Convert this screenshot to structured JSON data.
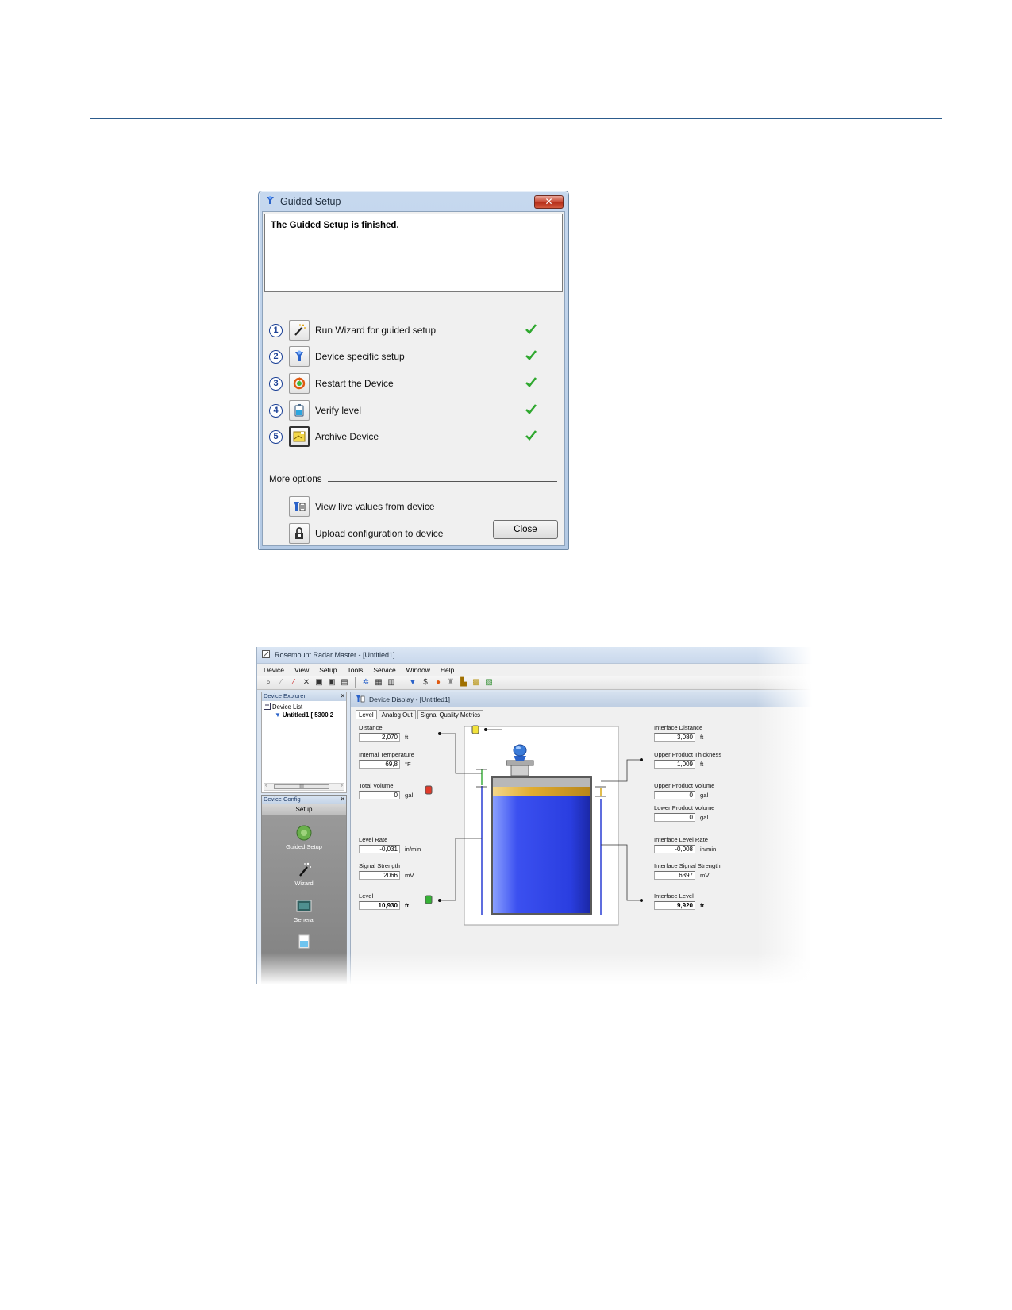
{
  "guided_setup": {
    "title": "Guided Setup",
    "message": "The Guided Setup is finished.",
    "steps": [
      {
        "num": "1",
        "label": "Run Wizard for guided setup",
        "icon": "wand-icon"
      },
      {
        "num": "2",
        "label": "Device specific setup",
        "icon": "radar-device-icon"
      },
      {
        "num": "3",
        "label": "Restart the Device",
        "icon": "restart-icon"
      },
      {
        "num": "4",
        "label": "Verify level",
        "icon": "tank-icon"
      },
      {
        "num": "5",
        "label": "Archive Device",
        "icon": "archive-icon"
      }
    ],
    "more_options_label": "More options",
    "options": [
      {
        "label": "View live values from device",
        "icon": "live-values-icon"
      },
      {
        "label": "Upload configuration to device",
        "icon": "upload-lock-icon"
      }
    ],
    "close_label": "Close"
  },
  "radar_master": {
    "title": "Rosemount Radar Master - [Untitled1]",
    "menu": [
      "Device",
      "View",
      "Setup",
      "Tools",
      "Service",
      "Window",
      "Help"
    ],
    "device_explorer": {
      "title": "Device Explorer",
      "device_list": "Device List",
      "device_entry": "Untitled1 [ 5300  2",
      "scroll_label": "III"
    },
    "device_config": {
      "title": "Device Config",
      "tab": "Setup",
      "items": [
        "Guided Setup",
        "Wizard",
        "General"
      ]
    },
    "device_display": {
      "title": "Device Display - [Untitled1]",
      "tabs": [
        "Level",
        "Analog Out",
        "Signal Quality Metrics"
      ],
      "left_fields": [
        {
          "label": "Distance",
          "value": "2,070",
          "unit": "ft"
        },
        {
          "label": "Internal Temperature",
          "value": "69,8",
          "unit": "°F"
        },
        {
          "label": "Total Volume",
          "value": "0",
          "unit": "gal"
        },
        {
          "label": "Level Rate",
          "value": "-0,031",
          "unit": "in/min"
        },
        {
          "label": "Signal Strength",
          "value": "2066",
          "unit": "mV"
        },
        {
          "label": "Level",
          "value": "10,930",
          "unit": "ft"
        }
      ],
      "right_fields": [
        {
          "label": "Interface Distance",
          "value": "3,080",
          "unit": "ft"
        },
        {
          "label": "Upper Product Thickness",
          "value": "1,009",
          "unit": "ft"
        },
        {
          "label": "Upper Product Volume",
          "value": "0",
          "unit": "gal"
        },
        {
          "label": "Lower Product Volume",
          "value": "0",
          "unit": "gal"
        },
        {
          "label": "Interface Level Rate",
          "value": "-0,008",
          "unit": "in/min"
        },
        {
          "label": "Interface Signal Strength",
          "value": "6397",
          "unit": "mV"
        },
        {
          "label": "Interface Level",
          "value": "9,920",
          "unit": "ft"
        }
      ]
    }
  },
  "colors": {
    "rule": "#2c5b8c",
    "check": "#2fa82f",
    "tank_liquid": "#2f43e8",
    "tank_upper_product": "#e2b43a"
  }
}
